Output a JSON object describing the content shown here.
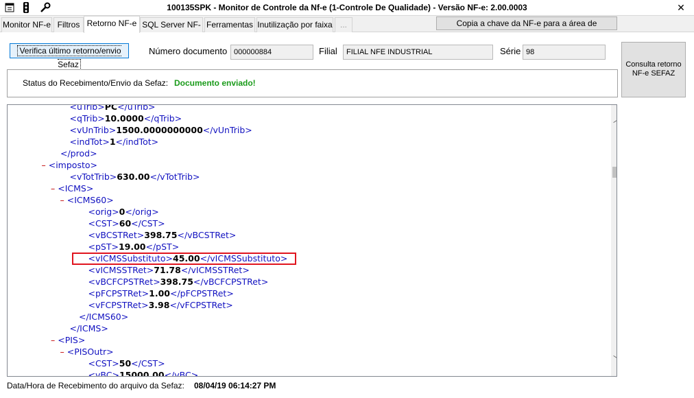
{
  "window": {
    "title": "100135SPK - Monitor de Controle da Nf-e (1-Controle De Qualidade) - Versão NF-e: 2.00.0003",
    "close_glyph": "✕",
    "icons": [
      "app-menu-icon",
      "traffic-light-icon",
      "wrench-icon"
    ]
  },
  "tabs": [
    {
      "label": "Monitor NF-e"
    },
    {
      "label": "Filtros"
    },
    {
      "label": "Retorno NF-e"
    },
    {
      "label": "SQL Server NF-e"
    },
    {
      "label": "Ferramentas"
    },
    {
      "label": "Inutilização por faixa"
    },
    {
      "label": "..."
    }
  ],
  "toolbar": {
    "copy_key_label": "Copia a chave da NF-e para a área de transferência",
    "verify_label": "Verifica último retorno/envio Sefaz",
    "consulta_label": "Consulta retorno NF-e SEFAZ"
  },
  "form": {
    "numero_label": "Número documento",
    "numero_value": "000000884",
    "filial_label": "Filial",
    "filial_value": "FILIAL NFE INDUSTRIAL",
    "serie_label": "Série",
    "serie_value": "98"
  },
  "status": {
    "label": "Status do Recebimento/Envio da Sefaz:",
    "value": "Documento enviado!",
    "value_color": "#1a9b1a"
  },
  "xml_lines": [
    {
      "indent": 1,
      "minus": "",
      "open": "<uTrib>",
      "value": "PC",
      "close": "</uTrib>"
    },
    {
      "indent": 1,
      "minus": "",
      "open": "<qTrib>",
      "value": "10.0000",
      "close": "</qTrib>"
    },
    {
      "indent": 1,
      "minus": "",
      "open": "<vUnTrib>",
      "value": "1500.0000000000",
      "close": "</vUnTrib>"
    },
    {
      "indent": 1,
      "minus": "",
      "open": "<indTot>",
      "value": "1",
      "close": "</indTot>"
    },
    {
      "indent": 0,
      "minus": "",
      "open": "</prod>",
      "value": "",
      "close": ""
    },
    {
      "indent": -1,
      "minus": "–",
      "open": "<imposto>",
      "value": "",
      "close": ""
    },
    {
      "indent": 1,
      "minus": "",
      "open": "<vTotTrib>",
      "value": "630.00",
      "close": "</vTotTrib>"
    },
    {
      "indent": 0,
      "minus": "–",
      "open": "<ICMS>",
      "value": "",
      "close": ""
    },
    {
      "indent": 1,
      "minus": "–",
      "open": "<ICMS60>",
      "value": "",
      "close": ""
    },
    {
      "indent": 3,
      "minus": "",
      "open": "<orig>",
      "value": "0",
      "close": "</orig>"
    },
    {
      "indent": 3,
      "minus": "",
      "open": "<CST>",
      "value": "60",
      "close": "</CST>"
    },
    {
      "indent": 3,
      "minus": "",
      "open": "<vBCSTRet>",
      "value": "398.75",
      "close": "</vBCSTRet>"
    },
    {
      "indent": 3,
      "minus": "",
      "open": "<pST>",
      "value": "19.00",
      "close": "</pST>"
    },
    {
      "indent": 3,
      "minus": "",
      "open": "<vICMSSubstituto>",
      "value": "45.00",
      "close": "</vICMSSubstituto>"
    },
    {
      "indent": 3,
      "minus": "",
      "open": "<vICMSSTRet>",
      "value": "71.78",
      "close": "</vICMSSTRet>"
    },
    {
      "indent": 3,
      "minus": "",
      "open": "<vBCFCPSTRet>",
      "value": "398.75",
      "close": "</vBCFCPSTRet>"
    },
    {
      "indent": 3,
      "minus": "",
      "open": "<pFCPSTRet>",
      "value": "1.00",
      "close": "</pFCPSTRet>"
    },
    {
      "indent": 3,
      "minus": "",
      "open": "<vFCPSTRet>",
      "value": "3.98",
      "close": "</vFCPSTRet>"
    },
    {
      "indent": 2,
      "minus": "",
      "open": "</ICMS60>",
      "value": "",
      "close": ""
    },
    {
      "indent": 1,
      "minus": "",
      "open": "</ICMS>",
      "value": "",
      "close": ""
    },
    {
      "indent": 0,
      "minus": "–",
      "open": "<PIS>",
      "value": "",
      "close": ""
    },
    {
      "indent": 1,
      "minus": "–",
      "open": "<PISOutr>",
      "value": "",
      "close": ""
    },
    {
      "indent": 3,
      "minus": "",
      "open": "<CST>",
      "value": "50",
      "close": "</CST>"
    },
    {
      "indent": 3,
      "minus": "",
      "open": "<vBC>",
      "value": "15000.00",
      "close": "</vBC>"
    }
  ],
  "footer": {
    "label": "Data/Hora de Recebimento do arquivo da Sefaz:",
    "value": "08/04/19 06:14:27 PM"
  }
}
